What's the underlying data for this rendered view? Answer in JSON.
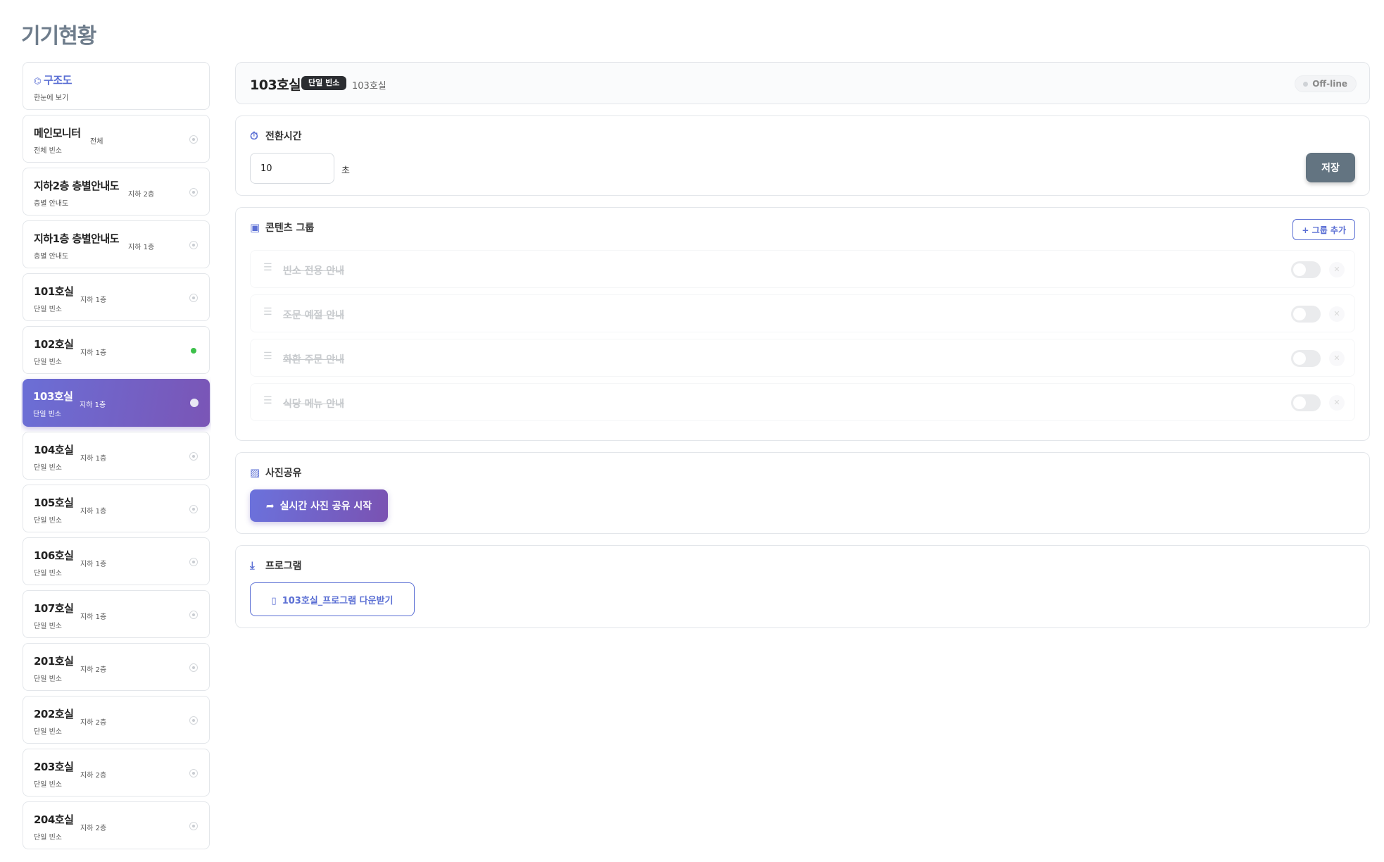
{
  "page": {
    "title": "기기현황"
  },
  "sidebar": {
    "structure": {
      "icon": "sitemap-icon",
      "label": "구조도",
      "sub": "한눈에 보기"
    },
    "items": [
      {
        "title": "메인모니터",
        "sub": "전체 빈소",
        "tag": "전체",
        "online": false,
        "active": false
      },
      {
        "title": "지하2층 층별안내도",
        "sub": "층별 안내도",
        "tag": "지하 2층",
        "online": false,
        "active": false
      },
      {
        "title": "지하1층 층별안내도",
        "sub": "층별 안내도",
        "tag": "지하 1층",
        "online": false,
        "active": false
      },
      {
        "title": "101호실",
        "sub": "단일 빈소",
        "tag": "지하 1층",
        "online": false,
        "active": false
      },
      {
        "title": "102호실",
        "sub": "단일 빈소",
        "tag": "지하 1층",
        "online": true,
        "active": false
      },
      {
        "title": "103호실",
        "sub": "단일 빈소",
        "tag": "지하 1층",
        "online": false,
        "active": true
      },
      {
        "title": "104호실",
        "sub": "단일 빈소",
        "tag": "지하 1층",
        "online": false,
        "active": false
      },
      {
        "title": "105호실",
        "sub": "단일 빈소",
        "tag": "지하 1층",
        "online": false,
        "active": false
      },
      {
        "title": "106호실",
        "sub": "단일 빈소",
        "tag": "지하 1층",
        "online": false,
        "active": false
      },
      {
        "title": "107호실",
        "sub": "단일 빈소",
        "tag": "지하 1층",
        "online": false,
        "active": false
      },
      {
        "title": "201호실",
        "sub": "단일 빈소",
        "tag": "지하 2층",
        "online": false,
        "active": false
      },
      {
        "title": "202호실",
        "sub": "단일 빈소",
        "tag": "지하 2층",
        "online": false,
        "active": false
      },
      {
        "title": "203호실",
        "sub": "단일 빈소",
        "tag": "지하 2층",
        "online": false,
        "active": false
      },
      {
        "title": "204호실",
        "sub": "단일 빈소",
        "tag": "지하 2층",
        "online": false,
        "active": false
      }
    ]
  },
  "header": {
    "title": "103호실",
    "badge": "단일 빈소",
    "sub": "103호실",
    "status": "Off-line"
  },
  "switch_time": {
    "icon": "stopwatch-icon",
    "title": "전환시간",
    "value": "10",
    "unit": "초",
    "save_label": "저장"
  },
  "content_groups": {
    "icon": "folder-icon",
    "title": "콘텐츠 그룹",
    "add_label": "+ 그룹 추가",
    "groups": [
      {
        "label": "빈소 전용 안내"
      },
      {
        "label": "조문 예절 안내"
      },
      {
        "label": "화환 주문 안내"
      },
      {
        "label": "식당 메뉴 안내"
      }
    ]
  },
  "photo_share": {
    "icon": "image-icon",
    "title": "사진공유",
    "button_icon": "share-icon",
    "button_label": "실시간 사진 공유 시작"
  },
  "program": {
    "icon": "download-icon",
    "title": "프로그램",
    "button_icon": "file-icon",
    "button_label": "103호실_프로그램 다운받기"
  },
  "colors": {
    "accent": "#5b6fd4",
    "active_gradient_start": "#6b6fd6",
    "active_gradient_end": "#7a55b6",
    "online": "#3cc04a",
    "save_button": "#637481"
  }
}
